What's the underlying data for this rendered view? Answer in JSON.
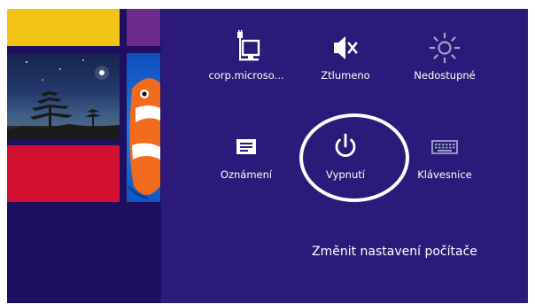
{
  "charms": {
    "network": {
      "label": "corp.microso...",
      "icon": "network-plug-icon"
    },
    "volume": {
      "label": "Ztlumeno",
      "icon": "speaker-muted-icon"
    },
    "brightness": {
      "label": "Nedostupné",
      "icon": "brightness-icon"
    },
    "notifications": {
      "label": "Oznámení",
      "icon": "notifications-icon"
    },
    "power": {
      "label": "Vypnutí",
      "icon": "power-icon"
    },
    "keyboard": {
      "label": "Klávesnice",
      "icon": "keyboard-icon"
    }
  },
  "change_pc_settings": "Změnit nastavení počítače",
  "colors": {
    "pane": "#2b1a79",
    "start_background": "#1e0f60",
    "tile_yellow": "#f3c316",
    "tile_red": "#d2102f",
    "tile_purple": "#6a2b8b",
    "tile_blue": "#1f7be0",
    "highlight_ring": "#ffffff"
  }
}
